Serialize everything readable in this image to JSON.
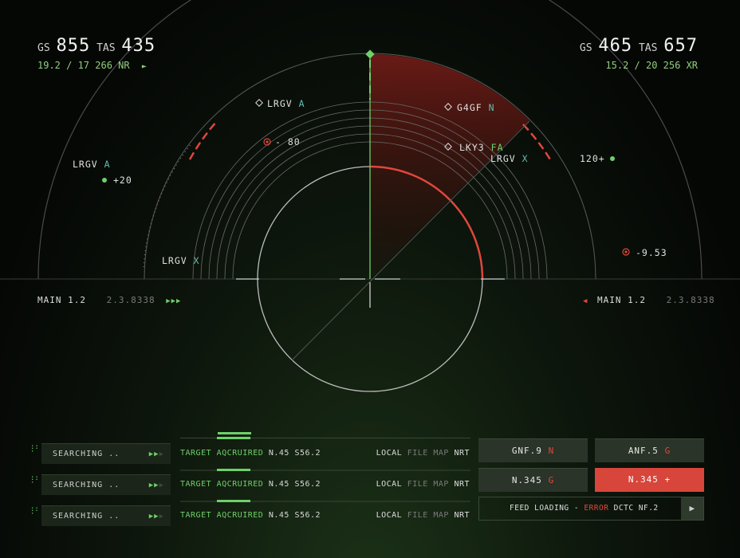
{
  "left_readout": {
    "gs_label": "GS",
    "gs_value": "855",
    "tas_label": "TAS",
    "tas_value": "435",
    "sub": "19.2 / 17 266 NR",
    "arrow": "►"
  },
  "right_readout": {
    "gs_label": "GS",
    "gs_value": "465",
    "tas_label": "TAS",
    "tas_value": "657",
    "sub": "15.2 / 20 256 XR"
  },
  "radar_labels": {
    "lrgv_a_top": {
      "name": "LRGV",
      "code": "A"
    },
    "g4gf": {
      "name": "G4GF",
      "code": "N"
    },
    "lky3": {
      "name": "LKY3",
      "code": "FA"
    },
    "lrgv_x_right": {
      "name": "LRGV",
      "code": "X"
    },
    "lrgv_a_left": {
      "name": "LRGV",
      "code": "A"
    },
    "lrgv_x_bottom": {
      "name": "LRGV",
      "code": "X"
    },
    "val_minus80": "- 80",
    "val_plus20": "+20",
    "val_120": "120+",
    "val_minus953": "-9.53"
  },
  "main_left": {
    "label": "MAIN 1.2",
    "value": "2.3.8338",
    "arrows": "▶▶▶"
  },
  "main_right": {
    "label": "MAIN 1.2",
    "value": "2.3.8338",
    "arrow": "◀"
  },
  "rows": [
    {
      "status": "SEARCHING ..",
      "target": "TARGET AQCRUIRED",
      "coords": "N.45 S56.2",
      "local": "LOCAL",
      "file": "FILE",
      "map": "MAP",
      "nrt": "NRT"
    },
    {
      "status": "SEARCHING ..",
      "target": "TARGET AQCRUIRED",
      "coords": "N.45 S56.2",
      "local": "LOCAL",
      "file": "FILE",
      "map": "MAP",
      "nrt": "NRT"
    },
    {
      "status": "SEARCHING ..",
      "target": "TARGET AQCRUIRED",
      "coords": "N.45 S56.2",
      "local": "LOCAL",
      "file": "FILE",
      "map": "MAP",
      "nrt": "NRT"
    }
  ],
  "buttons": [
    {
      "label": "GNF.9",
      "suffix": "N"
    },
    {
      "label": "ANF.5",
      "suffix": "G"
    },
    {
      "label": "N.345",
      "suffix": "G"
    },
    {
      "label": "N.345 +",
      "suffix": ""
    }
  ],
  "feed": {
    "prefix": "FEED LOADING -",
    "error": "ERROR",
    "suffix": "DCTC NF.2",
    "play": "▶"
  },
  "colors": {
    "accent_green": "#6fd06a",
    "alert_red": "#e0473d",
    "teal": "#5fbfb0"
  }
}
